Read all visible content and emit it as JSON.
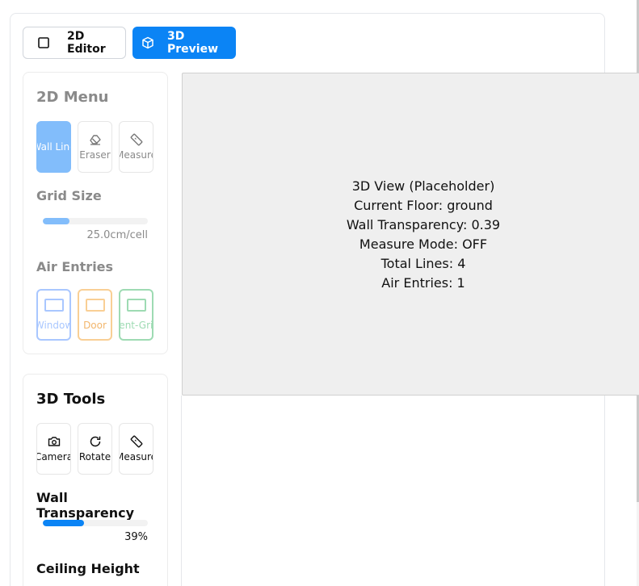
{
  "header": {
    "mode_2d_label": "2D Editor",
    "mode_3d_label": "3D Preview",
    "active_mode": "3D Preview"
  },
  "menu_2d": {
    "title": "2D Menu",
    "tools": [
      {
        "label": "Wall Line",
        "icon": "wall-line-icon",
        "active": true
      },
      {
        "label": "Eraser",
        "icon": "eraser-icon",
        "active": false
      },
      {
        "label": "Measure",
        "icon": "ruler-icon",
        "active": false
      }
    ],
    "grid_size": {
      "label": "Grid Size",
      "value_text": "25.0cm/cell",
      "level": 0.25
    },
    "air_entries": {
      "label": "Air Entries",
      "items": [
        {
          "label": "Window",
          "color": "#a9c7ff"
        },
        {
          "label": "Door",
          "color": "#f9cf95"
        },
        {
          "label": "Vent-Grid",
          "color": "#9edbb3"
        }
      ]
    }
  },
  "tools_3d": {
    "title": "3D Tools",
    "tools": [
      {
        "label": "Camera",
        "icon": "camera-icon"
      },
      {
        "label": "Rotate",
        "icon": "rotate-icon"
      },
      {
        "label": "Measure",
        "icon": "ruler-icon"
      }
    ],
    "wall_transparency": {
      "label": "Wall Transparency",
      "value_text": "39%",
      "level": 0.39
    },
    "ceiling_height": {
      "label": "Ceiling Height"
    }
  },
  "viewport": {
    "lines": [
      "3D View (Placeholder)",
      "Current Floor: ground",
      "Wall Transparency: 0.39",
      "Measure Mode: OFF",
      "Total Lines: 4",
      "Air Entries: 1"
    ]
  },
  "colors": {
    "accent": "#0b84f5",
    "accent_light": "#82bdfb",
    "viewport_bg": "#efefef"
  }
}
